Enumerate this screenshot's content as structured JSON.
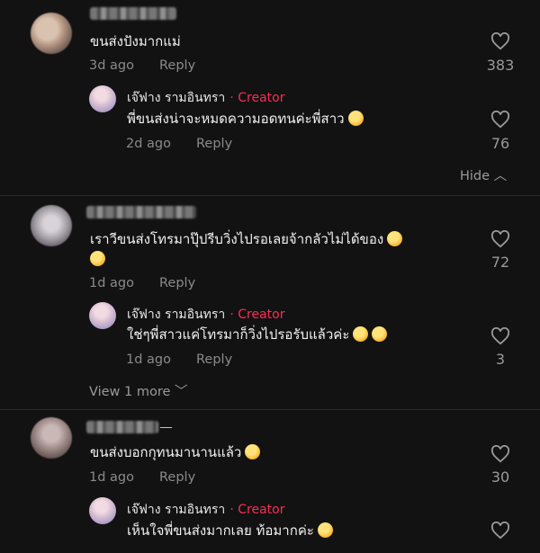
{
  "comments": [
    {
      "text": "ขนส่งปังมากแม่",
      "time": "3d ago",
      "reply": "Reply",
      "likes": "383",
      "sub": {
        "author": "เจ๊ฟาง รามอินทรา",
        "tag": "Creator",
        "text": "พี่ขนส่งน่าจะหมดความอดทนค่ะพี่สาว",
        "time": "2d ago",
        "reply": "Reply",
        "likes": "76"
      },
      "toggle": "Hide"
    },
    {
      "text_line1": "เราวีขนส่งโทรมาปุ๊ปรีบวิ่งไปรอเลยจ้ากลัวไม่ได้ของ",
      "time": "1d ago",
      "reply": "Reply",
      "likes": "72",
      "sub": {
        "author": "เจ๊ฟาง รามอินทรา",
        "tag": "Creator",
        "text": "ใช่ๆพี่สาวแค่โทรมาก็วิ่งไปรอรับแล้วค่ะ",
        "time": "1d ago",
        "reply": "Reply",
        "likes": "3"
      },
      "toggle": "View 1 more"
    },
    {
      "name_suffix": "__",
      "text": "ขนส่งบอกกุทนมานานแล้ว",
      "time": "1d ago",
      "reply": "Reply",
      "likes": "30",
      "sub": {
        "author": "เจ๊ฟาง รามอินทรา",
        "tag": "Creator",
        "text": "เห็นใจพี่ขนส่งมากเลย ท้อมากค่ะ"
      }
    }
  ]
}
